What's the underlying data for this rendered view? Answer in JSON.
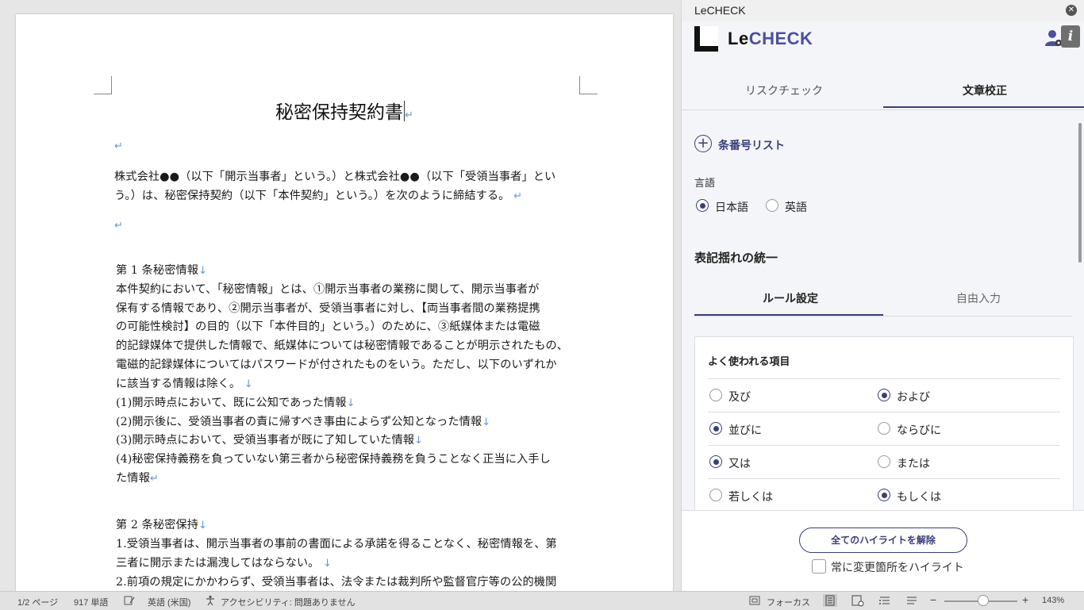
{
  "document": {
    "title": "秘密保持契約書",
    "para_mark": "↵",
    "line_mark": "↓",
    "intro": [
      "株式会社●●（以下「開示当事者」という。）と株式会社●●（以下「受領当事者」とい",
      "う。）は、秘密保持契約（以下「本件契約」という。）を次のように締結する。"
    ],
    "article1": {
      "heading": "第 1 条秘密情報",
      "lines": [
        "本件契約において、「秘密情報」とは、①開示当事者の業務に関して、開示当事者が",
        "保有する情報であり、②開示当事者が、受領当事者に対し、【両当事者間の業務提携",
        "の可能性検討】の目的（以下「本件目的」という。）のために、③紙媒体または電磁",
        "的記録媒体で提供した情報で、紙媒体については秘密情報であることが明示されたもの、",
        "電磁的記録媒体についてはパスワードが付されたものをいう。ただし、以下のいずれか",
        "に該当する情報は除く。"
      ],
      "items": [
        "(1)開示時点において、既に公知であった情報",
        "(2)開示後に、受領当事者の責に帰すべき事由によらず公知となった情報",
        "(3)開示時点において、受領当事者が既に了知していた情報",
        "(4)秘密保持義務を負っていない第三者から秘密保持義務を負うことなく正当に入手し",
        "た情報"
      ]
    },
    "article2": {
      "heading": "第 2 条秘密保持",
      "lines": [
        "1.受領当事者は、開示当事者の事前の書面による承諾を得ることなく、秘密情報を、第",
        "三者に開示または漏洩してはならない。",
        "2.前項の規定にかかわらず、受領当事者は、法令または裁判所や監督官庁等の公的機関"
      ]
    }
  },
  "pane": {
    "window_title": "LeCHECK",
    "close_glyph": "✕",
    "brand_le": "Le",
    "brand_check": "CHECK",
    "info_glyph": "i",
    "tabs": [
      "リスクチェック",
      "文章校正"
    ],
    "add_list_label": "条番号リスト",
    "language_label": "言語",
    "languages": [
      {
        "label": "日本語",
        "selected": true
      },
      {
        "label": "英語",
        "selected": false
      }
    ],
    "section_title": "表記揺れの統一",
    "subtabs": [
      "ルール設定",
      "自由入力"
    ],
    "card_title": "よく使われる項目",
    "rules": [
      {
        "left": "及び",
        "left_selected": false,
        "right": "および",
        "right_selected": true
      },
      {
        "left": "並びに",
        "left_selected": true,
        "right": "ならびに",
        "right_selected": false
      },
      {
        "left": "又は",
        "left_selected": true,
        "right": "または",
        "right_selected": false
      },
      {
        "left": "若しくは",
        "left_selected": false,
        "right": "もしくは",
        "right_selected": true
      }
    ],
    "clear_button": "全てのハイライトを解除",
    "always_highlight_label": "常に変更箇所をハイライト",
    "always_highlight_checked": false
  },
  "status_bar": {
    "page": "1/2 ページ",
    "words": "917 単語",
    "language": "英語 (米国)",
    "accessibility": "アクセシビリティ: 問題ありません",
    "focus": "フォーカス",
    "zoom": "143%",
    "minus": "−",
    "plus": "+"
  }
}
